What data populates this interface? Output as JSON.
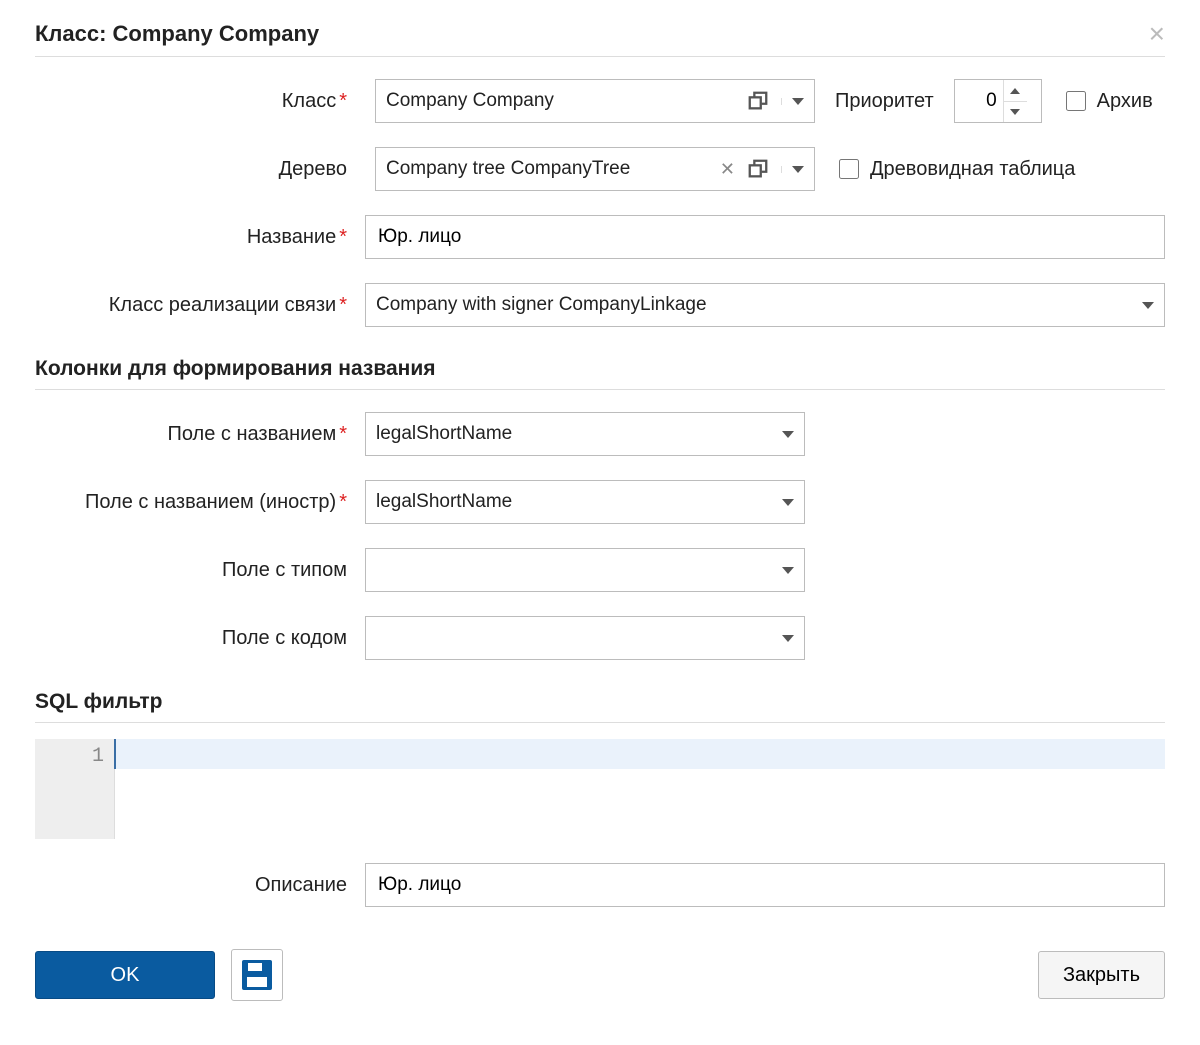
{
  "title": "Класс: Company Company",
  "labels": {
    "class": "Класс",
    "priority": "Приоритет",
    "archive": "Архив",
    "tree": "Дерево",
    "treeTable": "Древовидная таблица",
    "name": "Название",
    "linkClass": "Класс реализации связи",
    "nameField": "Поле с названием",
    "nameFieldForeign": "Поле с названием (иностр)",
    "typeField": "Поле с типом",
    "codeField": "Поле с кодом",
    "description": "Описание"
  },
  "sections": {
    "nameColumns": "Колонки для формирования названия",
    "sqlFilter": "SQL фильтр"
  },
  "values": {
    "class": "Company Company",
    "priority": "0",
    "archive": false,
    "tree": "Company tree CompanyTree",
    "treeTable": false,
    "name": "Юр. лицо",
    "linkClass": "Company with signer CompanyLinkage",
    "nameField": "legalShortName",
    "nameFieldForeign": "legalShortName",
    "typeField": "",
    "codeField": "",
    "description": "Юр. лицо"
  },
  "editor": {
    "lineNumber": "1",
    "content": ""
  },
  "buttons": {
    "ok": "OK",
    "close": "Закрыть"
  }
}
